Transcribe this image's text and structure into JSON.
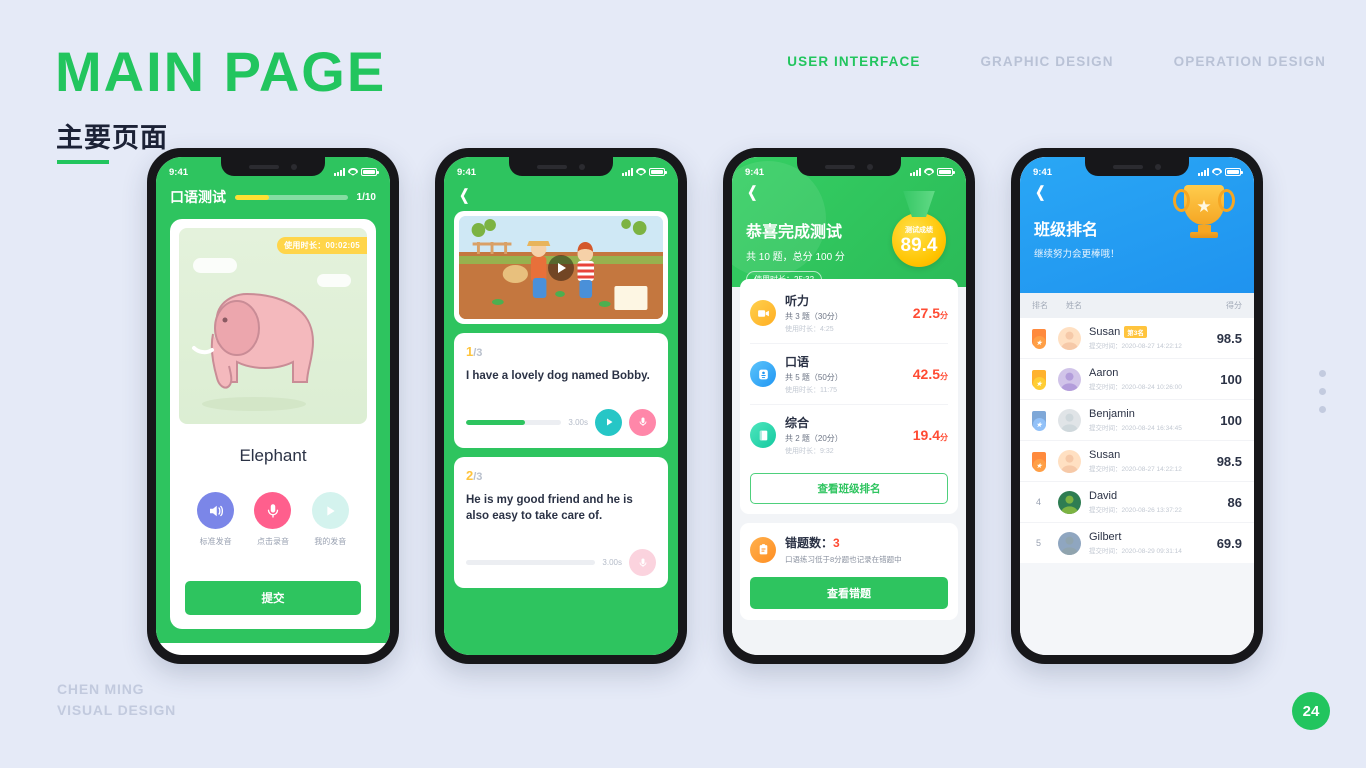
{
  "slide": {
    "title": "MAIN PAGE",
    "subtitle": "主要页面",
    "credit_line1": "CHEN MING",
    "credit_line2": "VISUAL DESIGN",
    "page_number": "24",
    "accent_green": "#22c55e",
    "background": "#e5eaf7"
  },
  "topnav": {
    "items": [
      {
        "label": "USER INTERFACE",
        "active": true
      },
      {
        "label": "GRAPHIC DESIGN",
        "active": false
      },
      {
        "label": "OPERATION DESIGN",
        "active": false
      }
    ]
  },
  "status_bar": {
    "time": "9:41"
  },
  "phone1": {
    "title": "口语测试",
    "progress_count": "1/10",
    "progress_percent": 30,
    "timer_badge": "使用时长：00:02:05",
    "word": "Elephant",
    "controls": [
      {
        "label": "标准发音",
        "icon": "speaker-icon",
        "color": "#7b86e8"
      },
      {
        "label": "点击录音",
        "icon": "microphone-icon",
        "color": "#ff5f8d"
      },
      {
        "label": "我的发音",
        "icon": "play-icon",
        "color": "#d4f3ee"
      }
    ],
    "submit_label": "提交"
  },
  "phone2": {
    "video_icon": "play-icon",
    "back_icon": "chevron-left-icon",
    "questions": [
      {
        "index": "1",
        "total": "/3",
        "text": "I have a lovely dog named Bobby.",
        "duration": "3.00s",
        "progress_percent": 62,
        "active": true,
        "play_icon": "play-icon",
        "mic_icon": "microphone-icon"
      },
      {
        "index": "2",
        "total": "/3",
        "text": "He is my good friend and he is also easy to take care of.",
        "duration": "3.00s",
        "progress_percent": 0,
        "active": false,
        "play_icon": "play-icon",
        "mic_icon": "microphone-icon"
      }
    ]
  },
  "phone3": {
    "back_icon": "chevron-left-icon",
    "heading": "恭喜完成测试",
    "subheading": "共 10 题，总分 100 分",
    "duration_badge": "使用时长：25:32",
    "medal_caption": "测试成绩",
    "medal_score": "89.4",
    "sections": [
      {
        "name": "听力",
        "meta": "共 3 题（30分）",
        "time": "使用时长：4:25",
        "score": "27.5",
        "unit": "分",
        "icon": "video-icon",
        "color": "#ffb22e"
      },
      {
        "name": "口语",
        "meta": "共 5 题（50分）",
        "time": "使用时长：11:75",
        "score": "42.5",
        "unit": "分",
        "icon": "speech-icon",
        "color": "#35a9f5"
      },
      {
        "name": "综合",
        "meta": "共 2 题（20分）",
        "time": "使用时长：9:32",
        "score": "19.4",
        "unit": "分",
        "icon": "book-icon",
        "color": "#26d4ae"
      }
    ],
    "rank_button": "查看班级排名",
    "wrong_icon": "clipboard-icon",
    "wrong_label": "错题数：",
    "wrong_count": "3",
    "wrong_note": "口语练习低于8分题也记录在错题中",
    "wrong_button": "查看错题"
  },
  "phone4": {
    "back_icon": "chevron-left-icon",
    "heading": "班级排名",
    "subheading": "继续努力会更棒哦！",
    "trophy_icon": "trophy-icon",
    "columns": {
      "rank": "排名",
      "name": "姓名",
      "score": "得分"
    },
    "rows": [
      {
        "rank": "1",
        "medal": true,
        "medal_color": "#ff8a3d",
        "name": "Susan",
        "tag": "第3名",
        "time": "提交时间：2020-08-27  14:22:12",
        "score": "98.5"
      },
      {
        "rank": "2",
        "medal": true,
        "medal_color": "#ffb22e",
        "name": "Aaron",
        "tag": "",
        "time": "提交时间：2020-08-24  10:26:00",
        "score": "100"
      },
      {
        "rank": "3",
        "medal": true,
        "medal_color": "#7fa8d8",
        "name": "Benjamin",
        "tag": "",
        "time": "提交时间：2020-08-24  16:34:45",
        "score": "100"
      },
      {
        "rank": "3",
        "medal": true,
        "medal_color": "#ff8a3d",
        "name": "Susan",
        "tag": "",
        "time": "提交时间：2020-08-27  14:22:12",
        "score": "98.5"
      },
      {
        "rank": "4",
        "medal": false,
        "medal_color": "",
        "name": "David",
        "tag": "",
        "time": "提交时间：2020-08-26  13:37:22",
        "score": "86"
      },
      {
        "rank": "5",
        "medal": false,
        "medal_color": "",
        "name": "Gilbert",
        "tag": "",
        "time": "提交时间：2020-08-29  09:31:14",
        "score": "69.9"
      }
    ]
  }
}
